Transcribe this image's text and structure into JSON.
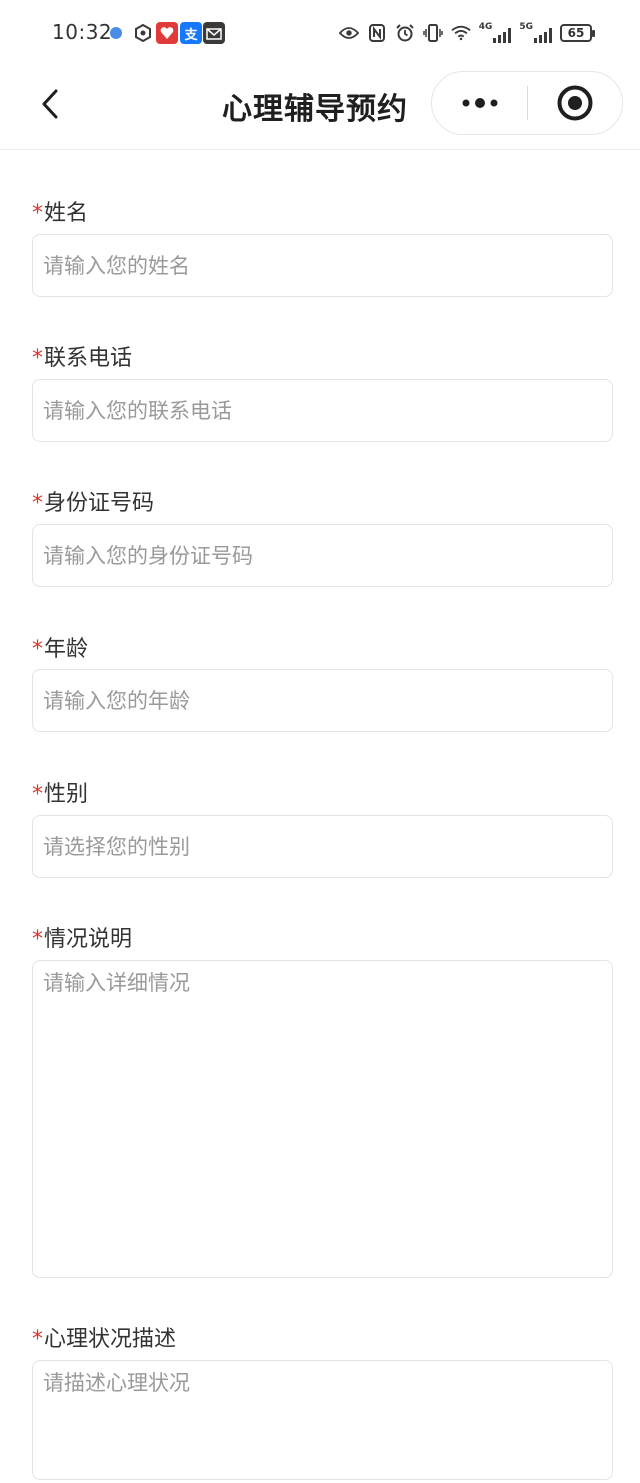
{
  "status_bar": {
    "time": "10:32",
    "network_4g": "4G",
    "network_5g": "5G",
    "battery": "65",
    "alipay_label": "支"
  },
  "nav": {
    "title": "心理辅导预约"
  },
  "form": {
    "fields": [
      {
        "label": "姓名",
        "required": "*",
        "placeholder": "请输入您的姓名"
      },
      {
        "label": "联系电话",
        "required": "*",
        "placeholder": "请输入您的联系电话"
      },
      {
        "label": "身份证号码",
        "required": "*",
        "placeholder": "请输入您的身份证号码"
      },
      {
        "label": "年龄",
        "required": "*",
        "placeholder": "请输入您的年龄"
      },
      {
        "label": "性别",
        "required": "*",
        "placeholder": "请选择您的性别"
      },
      {
        "label": "情况说明",
        "required": "*",
        "placeholder": "请输入详细情况"
      },
      {
        "label": "心理状况描述",
        "required": "*",
        "placeholder": "请描述心理状况"
      }
    ]
  }
}
